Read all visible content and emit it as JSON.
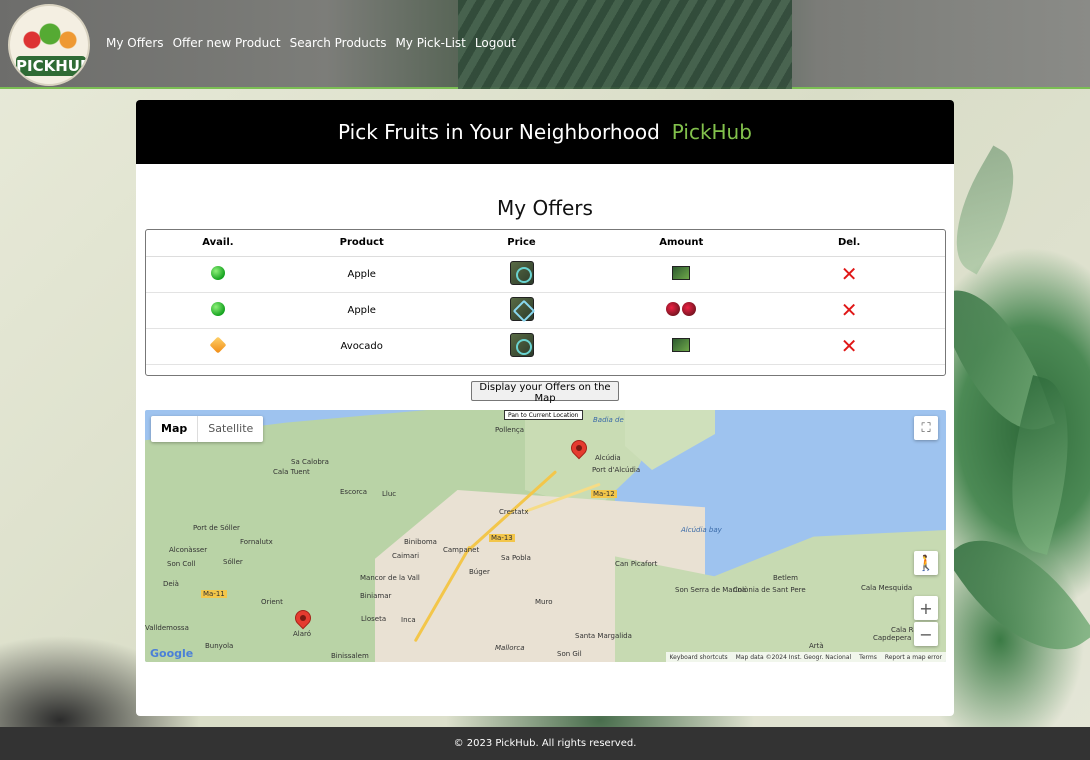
{
  "app": {
    "logo_text": "PICKHUB"
  },
  "nav": {
    "items": [
      {
        "label": "My Offers"
      },
      {
        "label": "Offer new Product"
      },
      {
        "label": "Search Products"
      },
      {
        "label": "My Pick-List"
      },
      {
        "label": "Logout"
      }
    ]
  },
  "hero": {
    "title": "Pick Fruits in Your Neighborhood",
    "brand": "PickHub"
  },
  "offers": {
    "title": "My Offers",
    "columns": [
      "Avail.",
      "Product",
      "Price",
      "Amount",
      "Del."
    ],
    "rows": [
      {
        "availability": "green-dot-icon",
        "product": "Apple",
        "price_icon": "price-round-icon",
        "amount_icon": "amount-box-icon"
      },
      {
        "availability": "green-dot-icon",
        "product": "Apple",
        "price_icon": "price-swap-icon",
        "amount_icon": "two-fruits-icon"
      },
      {
        "availability": "orange-diamond-icon",
        "product": "Avocado",
        "price_icon": "price-round-icon",
        "amount_icon": "amount-box-icon"
      }
    ],
    "delete_icon": "red-x-icon"
  },
  "map_button": {
    "label": "Display your Offers on the Map"
  },
  "map": {
    "type_active": "Map",
    "type_inactive": "Satellite",
    "pan_label": "Pan to Current Location",
    "zoom_in": "+",
    "zoom_out": "−",
    "google": "Google",
    "footer": {
      "shortcuts": "Keyboard shortcuts",
      "data": "Map data ©2024 Inst. Geogr. Nacional",
      "terms": "Terms",
      "report": "Report a map error"
    },
    "labels": {
      "pollenca": "Pollença",
      "sa_calobra": "Sa Calobra",
      "cala_tuent": "Cala Tuent",
      "escorca": "Escorca",
      "lluc": "Lluc",
      "alcudia": "Alcúdia",
      "port_alcudia": "Port d'Alcúdia",
      "crestatx": "Crestatx",
      "port_soller": "Port de Sóller",
      "fornalutx": "Fornalutx",
      "alconasser": "Alconàsser",
      "son_coll": "Son Coll",
      "soller": "Sóller",
      "biniboma": "Biniboma",
      "caimari": "Caimari",
      "campanet": "Campanet",
      "sa_pobla": "Sa Pobla",
      "buger": "Búger",
      "can_picafort": "Can Picafort",
      "deia": "Deià",
      "mancor": "Mancor de la Vall",
      "biniamar": "Biniamar",
      "lloseta": "Lloseta",
      "inca": "Inca",
      "muro": "Muro",
      "orient": "Orient",
      "alaro": "Alaró",
      "bunyola": "Bunyola",
      "binissalem": "Binissalem",
      "mancor2": "Mallorca",
      "son_gil": "Son Gil",
      "santa_margalida": "Santa Margalida",
      "son_serra": "Son Serra de Marina",
      "colonia": "Colònia de Sant Pere",
      "betlem": "Betlem",
      "cala_mesquida": "Cala Mesquida",
      "cala_ratjada": "Cala Ratjada",
      "capdepera": "Capdepera",
      "arta": "Artà",
      "alcudia_bay": "Alcúdia bay",
      "badia": "Badia de",
      "valldemossa": "Valldemossa",
      "ma12": "Ma-12",
      "ma13": "Ma-13",
      "ma11": "Ma-11"
    }
  },
  "footer": {
    "text": "© 2023 PickHub. All rights reserved."
  },
  "colors": {
    "brand_green": "#82c14c",
    "delete_red": "#e01717"
  }
}
